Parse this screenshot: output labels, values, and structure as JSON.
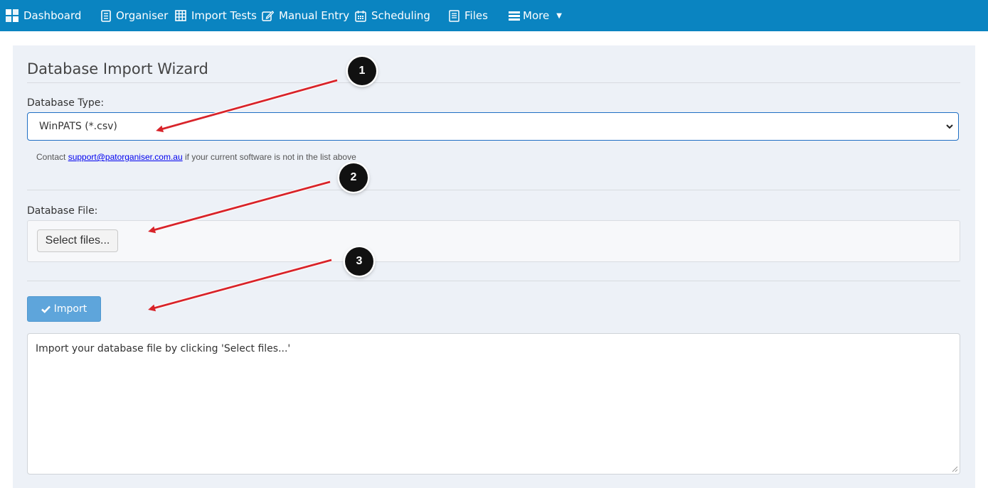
{
  "nav": {
    "items": [
      {
        "label": "Dashboard",
        "icon": "dashboard-icon"
      },
      {
        "label": "Organiser",
        "icon": "organiser-icon"
      },
      {
        "label": "Import Tests",
        "icon": "table-icon"
      },
      {
        "label": "Manual Entry",
        "icon": "edit-icon"
      },
      {
        "label": "Scheduling",
        "icon": "calendar-icon"
      },
      {
        "label": "Files",
        "icon": "file-icon"
      },
      {
        "label": "More",
        "icon": "list-icon"
      }
    ]
  },
  "wizard": {
    "title": "Database Import Wizard",
    "type_label": "Database Type:",
    "type_value": "WinPATS (*.csv)",
    "help_prefix": "Contact",
    "help_email": "support@patorganiser.com.au",
    "help_suffix": "if your current software is not in the list above",
    "file_label": "Database File:",
    "select_files": "Select files...",
    "import_label": "Import",
    "log_text": "Import your database file by clicking 'Select files...'"
  },
  "annotations": [
    "1",
    "2",
    "3"
  ],
  "colors": {
    "navbar": "#0a84c1",
    "panel": "#edf1f7",
    "primary_button": "#5ea5db",
    "arrow": "#d8242a"
  }
}
